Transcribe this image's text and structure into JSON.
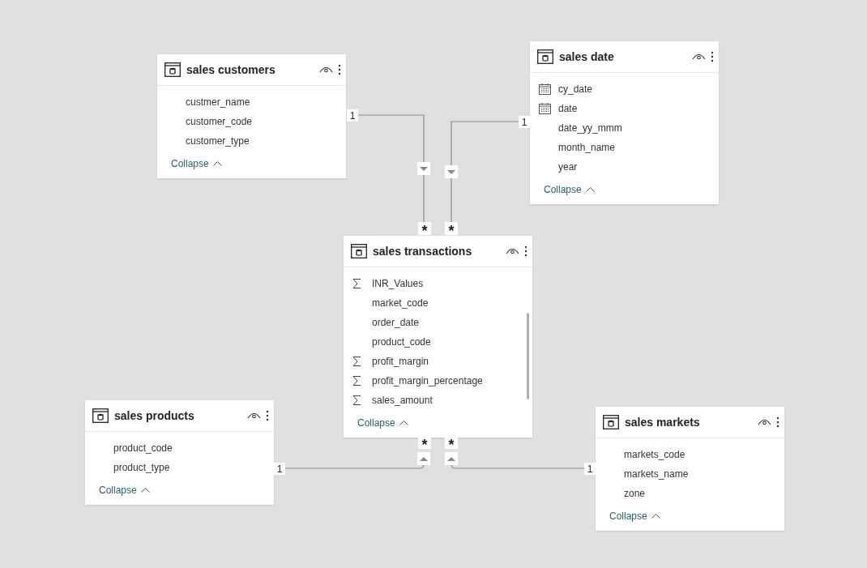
{
  "tables": [
    {
      "name": "sales customers",
      "fields": [
        {
          "name": "custmer_name",
          "kind": "plain"
        },
        {
          "name": "customer_code",
          "kind": "plain"
        },
        {
          "name": "customer_type",
          "kind": "plain"
        }
      ],
      "collapse": "Collapse"
    },
    {
      "name": "sales date",
      "fields": [
        {
          "name": "cy_date",
          "kind": "date"
        },
        {
          "name": "date",
          "kind": "date"
        },
        {
          "name": "date_yy_mmm",
          "kind": "plain"
        },
        {
          "name": "month_name",
          "kind": "plain"
        },
        {
          "name": "year",
          "kind": "plain"
        }
      ],
      "collapse": "Collapse"
    },
    {
      "name": "sales transactions",
      "fields": [
        {
          "name": "INR_Values",
          "kind": "sum"
        },
        {
          "name": "market_code",
          "kind": "plain"
        },
        {
          "name": "order_date",
          "kind": "plain"
        },
        {
          "name": "product_code",
          "kind": "plain"
        },
        {
          "name": "profit_margin",
          "kind": "sum"
        },
        {
          "name": "profit_margin_percentage",
          "kind": "sum"
        },
        {
          "name": "sales_amount",
          "kind": "sum"
        }
      ],
      "collapse": "Collapse"
    },
    {
      "name": "sales products",
      "fields": [
        {
          "name": "product_code",
          "kind": "plain"
        },
        {
          "name": "product_type",
          "kind": "plain"
        }
      ],
      "collapse": "Collapse"
    },
    {
      "name": "sales markets",
      "fields": [
        {
          "name": "markets_code",
          "kind": "plain"
        },
        {
          "name": "markets_name",
          "kind": "plain"
        },
        {
          "name": "zone",
          "kind": "plain"
        }
      ],
      "collapse": "Collapse"
    }
  ],
  "relationships": [
    {
      "one_end": "1",
      "many_end": "*"
    },
    {
      "one_end": "1",
      "many_end": "*"
    },
    {
      "one_end": "1",
      "many_end": "*"
    },
    {
      "one_end": "1",
      "many_end": "*"
    }
  ]
}
